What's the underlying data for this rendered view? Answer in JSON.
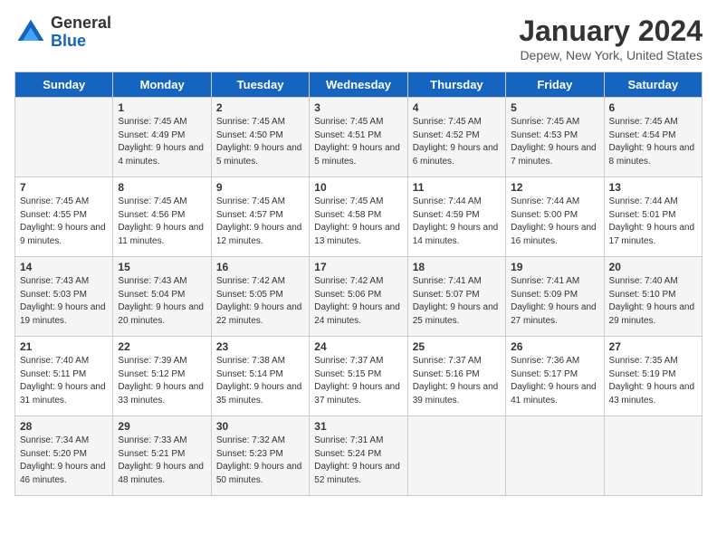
{
  "logo": {
    "general": "General",
    "blue": "Blue"
  },
  "title": "January 2024",
  "subtitle": "Depew, New York, United States",
  "weekdays": [
    "Sunday",
    "Monday",
    "Tuesday",
    "Wednesday",
    "Thursday",
    "Friday",
    "Saturday"
  ],
  "weeks": [
    [
      {
        "day": "",
        "sunrise": "",
        "sunset": "",
        "daylight": ""
      },
      {
        "day": "1",
        "sunrise": "Sunrise: 7:45 AM",
        "sunset": "Sunset: 4:49 PM",
        "daylight": "Daylight: 9 hours and 4 minutes."
      },
      {
        "day": "2",
        "sunrise": "Sunrise: 7:45 AM",
        "sunset": "Sunset: 4:50 PM",
        "daylight": "Daylight: 9 hours and 5 minutes."
      },
      {
        "day": "3",
        "sunrise": "Sunrise: 7:45 AM",
        "sunset": "Sunset: 4:51 PM",
        "daylight": "Daylight: 9 hours and 5 minutes."
      },
      {
        "day": "4",
        "sunrise": "Sunrise: 7:45 AM",
        "sunset": "Sunset: 4:52 PM",
        "daylight": "Daylight: 9 hours and 6 minutes."
      },
      {
        "day": "5",
        "sunrise": "Sunrise: 7:45 AM",
        "sunset": "Sunset: 4:53 PM",
        "daylight": "Daylight: 9 hours and 7 minutes."
      },
      {
        "day": "6",
        "sunrise": "Sunrise: 7:45 AM",
        "sunset": "Sunset: 4:54 PM",
        "daylight": "Daylight: 9 hours and 8 minutes."
      }
    ],
    [
      {
        "day": "7",
        "sunrise": "Sunrise: 7:45 AM",
        "sunset": "Sunset: 4:55 PM",
        "daylight": "Daylight: 9 hours and 9 minutes."
      },
      {
        "day": "8",
        "sunrise": "Sunrise: 7:45 AM",
        "sunset": "Sunset: 4:56 PM",
        "daylight": "Daylight: 9 hours and 11 minutes."
      },
      {
        "day": "9",
        "sunrise": "Sunrise: 7:45 AM",
        "sunset": "Sunset: 4:57 PM",
        "daylight": "Daylight: 9 hours and 12 minutes."
      },
      {
        "day": "10",
        "sunrise": "Sunrise: 7:45 AM",
        "sunset": "Sunset: 4:58 PM",
        "daylight": "Daylight: 9 hours and 13 minutes."
      },
      {
        "day": "11",
        "sunrise": "Sunrise: 7:44 AM",
        "sunset": "Sunset: 4:59 PM",
        "daylight": "Daylight: 9 hours and 14 minutes."
      },
      {
        "day": "12",
        "sunrise": "Sunrise: 7:44 AM",
        "sunset": "Sunset: 5:00 PM",
        "daylight": "Daylight: 9 hours and 16 minutes."
      },
      {
        "day": "13",
        "sunrise": "Sunrise: 7:44 AM",
        "sunset": "Sunset: 5:01 PM",
        "daylight": "Daylight: 9 hours and 17 minutes."
      }
    ],
    [
      {
        "day": "14",
        "sunrise": "Sunrise: 7:43 AM",
        "sunset": "Sunset: 5:03 PM",
        "daylight": "Daylight: 9 hours and 19 minutes."
      },
      {
        "day": "15",
        "sunrise": "Sunrise: 7:43 AM",
        "sunset": "Sunset: 5:04 PM",
        "daylight": "Daylight: 9 hours and 20 minutes."
      },
      {
        "day": "16",
        "sunrise": "Sunrise: 7:42 AM",
        "sunset": "Sunset: 5:05 PM",
        "daylight": "Daylight: 9 hours and 22 minutes."
      },
      {
        "day": "17",
        "sunrise": "Sunrise: 7:42 AM",
        "sunset": "Sunset: 5:06 PM",
        "daylight": "Daylight: 9 hours and 24 minutes."
      },
      {
        "day": "18",
        "sunrise": "Sunrise: 7:41 AM",
        "sunset": "Sunset: 5:07 PM",
        "daylight": "Daylight: 9 hours and 25 minutes."
      },
      {
        "day": "19",
        "sunrise": "Sunrise: 7:41 AM",
        "sunset": "Sunset: 5:09 PM",
        "daylight": "Daylight: 9 hours and 27 minutes."
      },
      {
        "day": "20",
        "sunrise": "Sunrise: 7:40 AM",
        "sunset": "Sunset: 5:10 PM",
        "daylight": "Daylight: 9 hours and 29 minutes."
      }
    ],
    [
      {
        "day": "21",
        "sunrise": "Sunrise: 7:40 AM",
        "sunset": "Sunset: 5:11 PM",
        "daylight": "Daylight: 9 hours and 31 minutes."
      },
      {
        "day": "22",
        "sunrise": "Sunrise: 7:39 AM",
        "sunset": "Sunset: 5:12 PM",
        "daylight": "Daylight: 9 hours and 33 minutes."
      },
      {
        "day": "23",
        "sunrise": "Sunrise: 7:38 AM",
        "sunset": "Sunset: 5:14 PM",
        "daylight": "Daylight: 9 hours and 35 minutes."
      },
      {
        "day": "24",
        "sunrise": "Sunrise: 7:37 AM",
        "sunset": "Sunset: 5:15 PM",
        "daylight": "Daylight: 9 hours and 37 minutes."
      },
      {
        "day": "25",
        "sunrise": "Sunrise: 7:37 AM",
        "sunset": "Sunset: 5:16 PM",
        "daylight": "Daylight: 9 hours and 39 minutes."
      },
      {
        "day": "26",
        "sunrise": "Sunrise: 7:36 AM",
        "sunset": "Sunset: 5:17 PM",
        "daylight": "Daylight: 9 hours and 41 minutes."
      },
      {
        "day": "27",
        "sunrise": "Sunrise: 7:35 AM",
        "sunset": "Sunset: 5:19 PM",
        "daylight": "Daylight: 9 hours and 43 minutes."
      }
    ],
    [
      {
        "day": "28",
        "sunrise": "Sunrise: 7:34 AM",
        "sunset": "Sunset: 5:20 PM",
        "daylight": "Daylight: 9 hours and 46 minutes."
      },
      {
        "day": "29",
        "sunrise": "Sunrise: 7:33 AM",
        "sunset": "Sunset: 5:21 PM",
        "daylight": "Daylight: 9 hours and 48 minutes."
      },
      {
        "day": "30",
        "sunrise": "Sunrise: 7:32 AM",
        "sunset": "Sunset: 5:23 PM",
        "daylight": "Daylight: 9 hours and 50 minutes."
      },
      {
        "day": "31",
        "sunrise": "Sunrise: 7:31 AM",
        "sunset": "Sunset: 5:24 PM",
        "daylight": "Daylight: 9 hours and 52 minutes."
      },
      {
        "day": "",
        "sunrise": "",
        "sunset": "",
        "daylight": ""
      },
      {
        "day": "",
        "sunrise": "",
        "sunset": "",
        "daylight": ""
      },
      {
        "day": "",
        "sunrise": "",
        "sunset": "",
        "daylight": ""
      }
    ]
  ]
}
